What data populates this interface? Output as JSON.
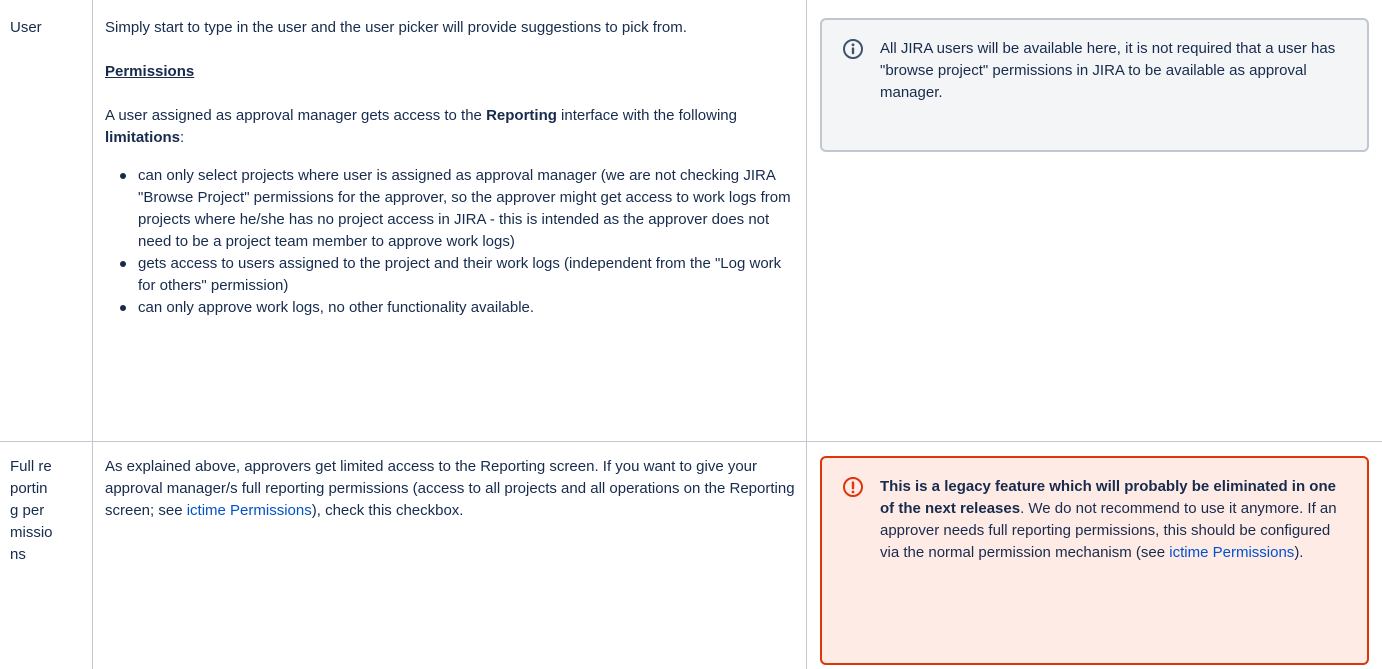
{
  "rows": [
    {
      "label": "User",
      "intro": "Simply start to type in the user and the user picker will provide suggestions to pick from.",
      "permissions_heading": "Permissions",
      "perm_text_1": "A user assigned as approval manager gets access to the ",
      "perm_bold_reporting": "Reporting",
      "perm_text_2": " interface with the following ",
      "perm_bold_limitations": "limitations",
      "perm_text_3": ":",
      "bullets": [
        "can only select projects where user is assigned as approval manager (we are not checking JIRA \"Browse Project\" permissions for the approver, so the approver might get access to work logs from projects where he/she has no project access in JIRA - this is intended as the approver does not need to be a project team member to approve work logs)",
        "gets access to users assigned to the project and their work logs (independent from the \"Log work for others\" permission)",
        "can only approve work logs, no other functionality available."
      ],
      "info_panel": {
        "icon": "info-icon",
        "text": "All JIRA users will be available here, it is not required that a user has \"browse project\" permissions in JIRA to be available as approval manager."
      }
    },
    {
      "label": "Full reporting permissions",
      "desc_text_1": "As explained above, approvers get limited access to the Reporting screen. If you want to give your approval manager/s full reporting permissions (access to all projects and all operations on the Reporting screen; see ",
      "desc_link": "ictime Permissions",
      "desc_text_2": "), check this checkbox.",
      "warning_panel": {
        "icon": "error-icon",
        "bold_text": "This is a legacy feature which will probably be eliminated in one of the next releases",
        "text_1": ". We do not recommend to use it anymore. If an approver needs full reporting permissions, this should be configured via the normal permission mechanism (see ",
        "link": "ictime Permissions",
        "text_2": ")."
      }
    }
  ],
  "colors": {
    "border": "#c1c7d0",
    "link": "#0052cc",
    "info_bg": "#f4f5f7",
    "error_border": "#de350b",
    "error_bg": "#ffebe6"
  }
}
